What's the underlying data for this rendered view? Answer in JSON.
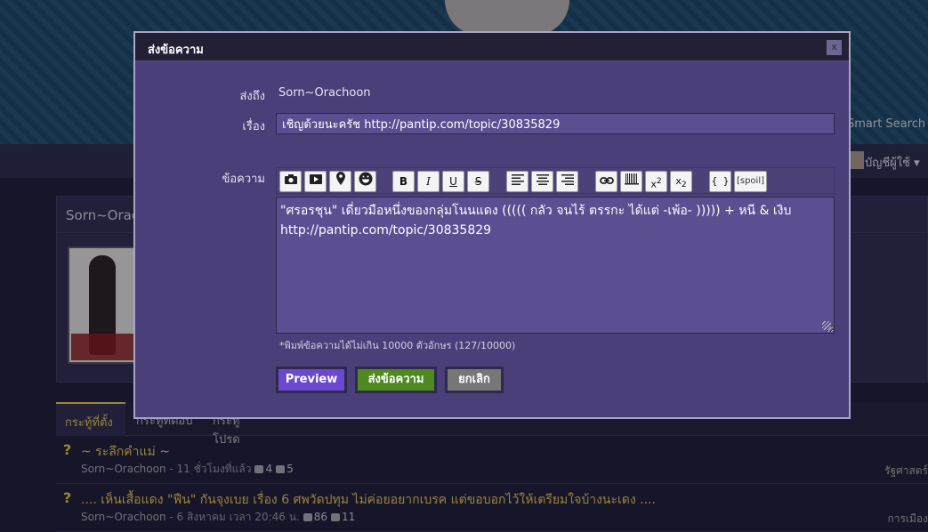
{
  "background": {
    "smart_search": "Smart Search",
    "user_menu": "บัญชีผู้ใช้ ▾",
    "profile_name": "Sorn~Orac",
    "tabs": [
      "กระทู้ที่ตั้ง",
      "กระทู้ที่ตอบ",
      "กระทู้โปรด"
    ],
    "posts": [
      {
        "q": "?",
        "title": "~ ระลึกคำแม่ ~",
        "author": "Sorn~Orachoon",
        "time": " - 11 ชั่วโมงที่แล้ว",
        "comments": "4",
        "votes": "5",
        "tag": "รัฐศาสตร์"
      },
      {
        "q": "?",
        "title": ".... เห็นเสื้อแดง \"ฟืน\" กันจุงเบย เรื่อง 6 ศพวัดปทุม ไม่ค่อยอยากเบรค แต่ขอบอกไว้ให้เตรียมใจบ้างนะเดง ....",
        "author": "Sorn~Orachoon",
        "time": " - 6 สิงหาคม เวลา 20:46 น.",
        "comments": "86",
        "votes": "11",
        "tag": "การเมือง"
      }
    ]
  },
  "dialog": {
    "title": "ส่งข้อความ",
    "close_label": "x",
    "to_label": "ส่งถึง",
    "to_value": "Sorn~Orachoon",
    "subject_label": "เรื่อง",
    "subject_value": "เชิญด้วยนะครัช http://pantip.com/topic/30835829",
    "message_label": "ข้อความ",
    "message_value": "\"ศรอรชุน\" เดี่ยวมือหนึ่งของกลุ่มโนนแดง ((((( กลัว จนไร้ ตรรกะ ได้แต่ -เพ้อ- ))))) + หนี & เงิบ\nhttp://pantip.com/topic/30835829",
    "counter": "*พิมพ์ข้อความได้ไม่เกิน 10000 ตัวอักษร (127/10000)",
    "buttons": {
      "preview": "Preview",
      "send": "ส่งข้อความ",
      "cancel": "ยกเลิก"
    },
    "toolbar": {
      "bold": "B",
      "italic": "I",
      "underline": "U",
      "strike": "S",
      "code": "{ }",
      "spoil": "[spoil]"
    }
  },
  "colors": {
    "dialog_bg": "#4a3f78",
    "input_bg": "#5b4f92",
    "preview_btn": "#6b48d0",
    "send_btn": "#4f8a20",
    "cancel_btn": "#777777",
    "accent_yellow": "#e8c64d"
  }
}
